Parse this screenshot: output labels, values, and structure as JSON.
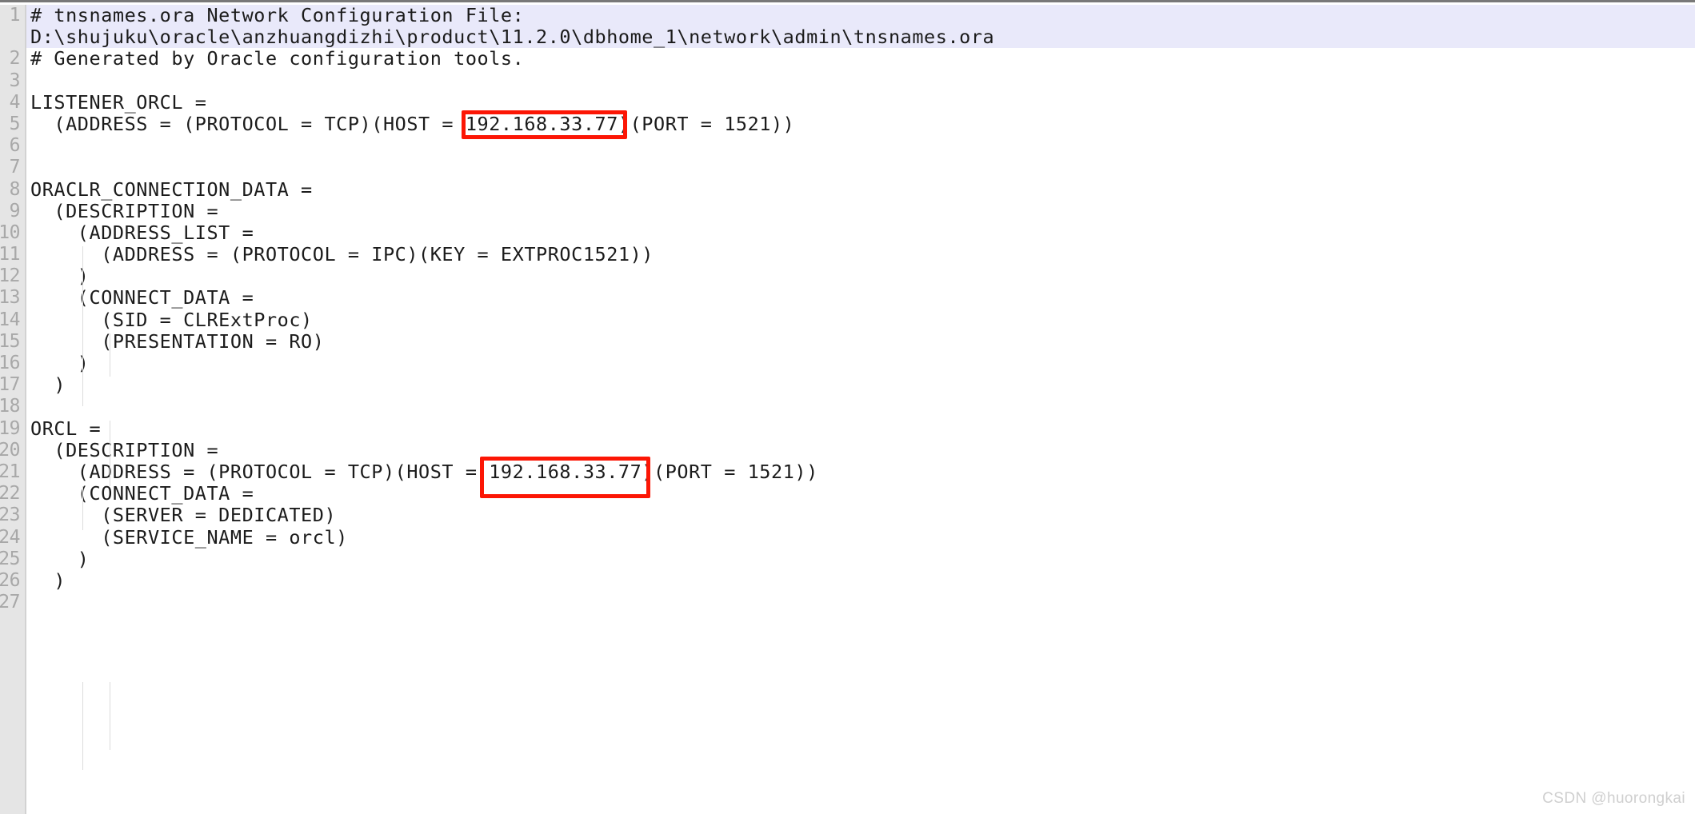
{
  "document": {
    "filename": "tnsnames.ora",
    "top_border_color": "#787878",
    "gutter_bg": "#e5e5e5",
    "line_number_color": "#a8a8a8",
    "highlight_bg": "#e9e9fa",
    "text_color": "#1b1b1b",
    "annotation_color": "#fc1605"
  },
  "gutter": {
    "numbers": [
      "1",
      "",
      "2",
      "3",
      "4",
      "5",
      "6",
      "7",
      "8",
      "9",
      "10",
      "11",
      "12",
      "13",
      "14",
      "15",
      "16",
      "17",
      "18",
      "19",
      "20",
      "21",
      "22",
      "23",
      "24",
      "25",
      "26",
      "27"
    ]
  },
  "code": {
    "lines": [
      {
        "text": "# tnsnames.ora Network Configuration File:",
        "highlight": true
      },
      {
        "text": "D:\\shujuku\\oracle\\anzhuangdizhi\\product\\11.2.0\\dbhome_1\\network\\admin\\tnsnames.ora",
        "highlight": true
      },
      {
        "text": "# Generated by Oracle configuration tools.",
        "highlight": false
      },
      {
        "text": "",
        "highlight": false
      },
      {
        "text": "LISTENER_ORCL =",
        "highlight": false
      },
      {
        "text": "  (ADDRESS = (PROTOCOL = TCP)(HOST = 192.168.33.77)(PORT = 1521))",
        "highlight": false
      },
      {
        "text": "",
        "highlight": false
      },
      {
        "text": "",
        "highlight": false
      },
      {
        "text": "ORACLR_CONNECTION_DATA =",
        "highlight": false
      },
      {
        "text": "  (DESCRIPTION =",
        "highlight": false
      },
      {
        "text": "    (ADDRESS_LIST =",
        "highlight": false
      },
      {
        "text": "      (ADDRESS = (PROTOCOL = IPC)(KEY = EXTPROC1521))",
        "highlight": false
      },
      {
        "text": "    )",
        "highlight": false
      },
      {
        "text": "    (CONNECT_DATA =",
        "highlight": false
      },
      {
        "text": "      (SID = CLRExtProc)",
        "highlight": false
      },
      {
        "text": "      (PRESENTATION = RO)",
        "highlight": false
      },
      {
        "text": "    )",
        "highlight": false
      },
      {
        "text": "  )",
        "highlight": false
      },
      {
        "text": "",
        "highlight": false
      },
      {
        "text": "ORCL =",
        "highlight": false
      },
      {
        "text": "  (DESCRIPTION =",
        "highlight": false
      },
      {
        "text": "    (ADDRESS = (PROTOCOL = TCP)(HOST = 192.168.33.77)(PORT = 1521))",
        "highlight": false
      },
      {
        "text": "    (CONNECT_DATA =",
        "highlight": false
      },
      {
        "text": "      (SERVER = DEDICATED)",
        "highlight": false
      },
      {
        "text": "      (SERVICE_NAME = orcl)",
        "highlight": false
      },
      {
        "text": "    )",
        "highlight": false
      },
      {
        "text": "  )",
        "highlight": false
      }
    ]
  },
  "annotations": {
    "boxes": [
      {
        "label": "192.168.33.77",
        "line": 5,
        "description": "listener-host-ip-highlight"
      },
      {
        "label": "192.168.33.77",
        "line": 21,
        "description": "orcl-host-ip-highlight"
      }
    ]
  },
  "watermark": {
    "text": "CSDN @huorongkai"
  }
}
